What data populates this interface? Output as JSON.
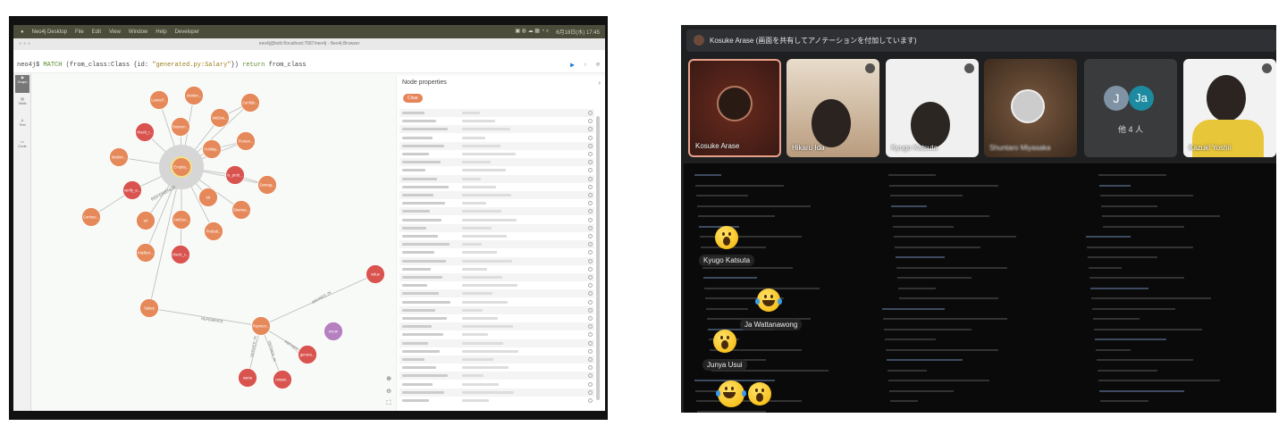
{
  "neo4j": {
    "menubar": {
      "items": [
        "Neo4j Desktop",
        "File",
        "Edit",
        "View",
        "Window",
        "Help",
        "Developer"
      ],
      "clock": "6月18日(水) 17:45"
    },
    "window_title": "neo4j@bolt://localhost:7687/neo4j - Neo4j Browser",
    "query": {
      "prompt": "neo4j$",
      "kw1": "MATCH",
      "part1": " (from_class:Class {id: ",
      "string": "\"generated.py:Salary\"",
      "part2": "}) ",
      "kw2": "return",
      "part3": " from_class"
    },
    "sidebar": [
      "Graph",
      "Table",
      "Text",
      "Code"
    ],
    "graph": {
      "nodes": [
        "Employ...",
        "LeaveP...",
        "Workin...",
        "Confide...",
        "IntrDes...",
        "Retirem...",
        "check_r...",
        "Person...",
        "Holiday...",
        "Workin...",
        "is_prob...",
        "Damag...",
        "verify_a...",
        "str",
        "Dismiss...",
        "Contrac...",
        "str",
        "AntiSoc...",
        "Probati...",
        "Intellect...",
        "check_c...",
        "Salary",
        "Paymen...",
        "value",
        "enum",
        "genera...",
        "name",
        "missin..."
      ],
      "edge_labels": [
        "REFERENCE",
        "DEFINED_IN",
        "DEFINED_IN",
        "DEFINED_IN",
        "DEFINED_IN"
      ],
      "colors": {
        "class": "#e6895a",
        "function": "#d9534f",
        "enum": "#b57fc0"
      }
    },
    "properties": {
      "title": "Node properties",
      "clear_label": "Clear"
    }
  },
  "meet": {
    "banner": "Kosuke Arase (画面を共有してアノテーションを付加しています)",
    "tiles": [
      {
        "name": "Kosuke Arase"
      },
      {
        "name": "Hikaru Ida"
      },
      {
        "name": "Kyugo Katsuta"
      },
      {
        "name": "Shuntaro Miyasaka"
      },
      {
        "name": "他 4 人",
        "avatars": [
          "J",
          "Ja"
        ]
      },
      {
        "name": "Kazuki Yoshii"
      }
    ],
    "annotations": [
      "Kyugo Katsuta",
      "Ja Wattanawong",
      "Junya Usui"
    ]
  }
}
